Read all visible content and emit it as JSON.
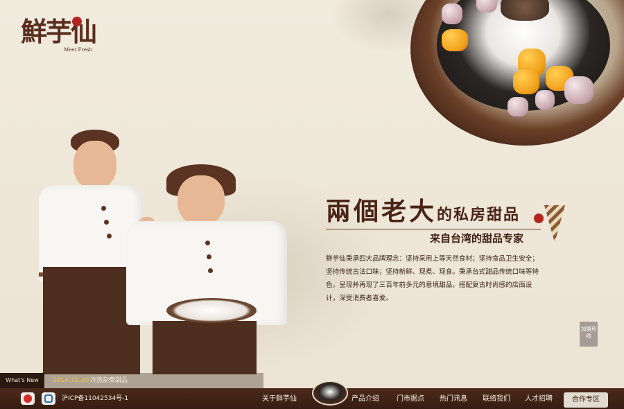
{
  "brand": {
    "name": "鮮芋仙",
    "tagline": "Meet Fresh"
  },
  "hero": {
    "headline_main": "兩個老大",
    "headline_tail": "的私房甜品",
    "subtitle": "来自台湾的甜品专家",
    "intro": "鮮芋仙秉承四大品牌理念：坚持采用上等天然食材；坚持食品卫生安全；坚持传统古法口味；坚持新鲜、现煮、现食。秉承台式甜品传统口味等特色，呈现并再现了三百年前多元的意境甜品，搭配复古时尚感的店面设计，深受消费者喜爱。"
  },
  "side_tab": {
    "label": "加盟热线"
  },
  "news": {
    "label": "What's New",
    "date": "2014-11-20",
    "title": "冷热杂煮甜品"
  },
  "footer": {
    "icp": "沪ICP备11042534号-1",
    "nav": [
      {
        "label": "关于鲜芋仙"
      },
      {
        "label": "产品介绍"
      },
      {
        "label": "门市据点"
      },
      {
        "label": "热门讯息"
      },
      {
        "label": "联络我们"
      },
      {
        "label": "人才招聘"
      }
    ],
    "cta": "合作专区"
  },
  "icons": {
    "weibo": "sina-weibo-icon",
    "tencent": "tencent-weibo-icon"
  },
  "colors": {
    "brand_brown": "#4b2a1b",
    "accent_gold": "#f3c43f",
    "seal_red": "#b3261e"
  }
}
